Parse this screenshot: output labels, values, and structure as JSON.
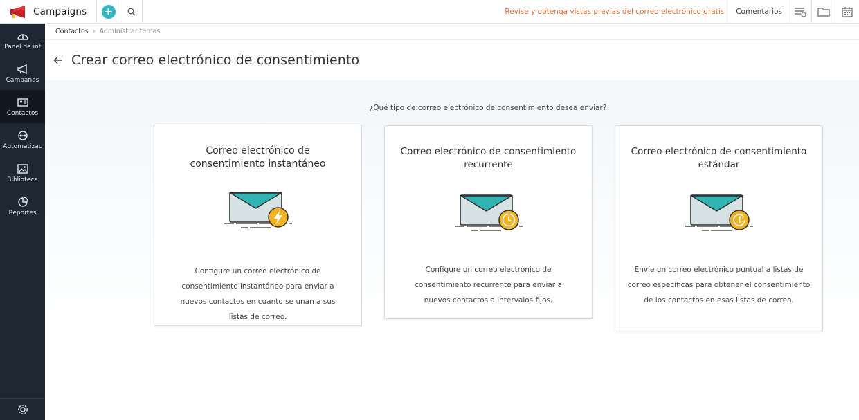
{
  "app": {
    "name": "Campaigns"
  },
  "topbar": {
    "promo": "Revise y obtenga vistas previas del correo electrónico gratis",
    "comments": "Comentarios"
  },
  "sidebar": {
    "items": [
      {
        "label": "Panel de inf",
        "icon": "dashboard-icon"
      },
      {
        "label": "Campañas",
        "icon": "megaphone-icon"
      },
      {
        "label": "Contactos",
        "icon": "contact-card-icon",
        "active": true
      },
      {
        "label": "Automatizac",
        "icon": "automation-icon"
      },
      {
        "label": "Biblioteca",
        "icon": "library-icon"
      },
      {
        "label": "Reportes",
        "icon": "reports-icon"
      }
    ]
  },
  "breadcrumb": {
    "item1": "Contactos",
    "item2": "Administrar temas"
  },
  "page": {
    "title": "Crear correo electrónico de consentimiento"
  },
  "content": {
    "question": "¿Qué tipo de correo electrónico de consentimiento desea enviar?",
    "cards": [
      {
        "title": "Correo electrónico de consentimiento instantáneo",
        "description": "Configure un correo electrónico de consentimiento instantáneo para enviar a nuevos contactos en cuanto se unan a sus listas de correo.",
        "badge_icon": "lightning-icon"
      },
      {
        "title": "Correo electrónico de consentimiento recurrente",
        "description": "Configure un correo electrónico de consentimiento recurrente para enviar a nuevos contactos a intervalos fijos.",
        "badge_icon": "clock-icon"
      },
      {
        "title": "Correo electrónico de consentimiento estándar",
        "description": "Envíe un correo electrónico puntual a listas de correo específicas para obtener el consentimiento de los contactos en esas listas de correo.",
        "badge_icon": "one-time-icon"
      }
    ]
  },
  "colors": {
    "teal": "#2cb8c4",
    "amber": "#f5b41f",
    "sidebar": "#1f2733",
    "promo": "#e36b2c"
  }
}
